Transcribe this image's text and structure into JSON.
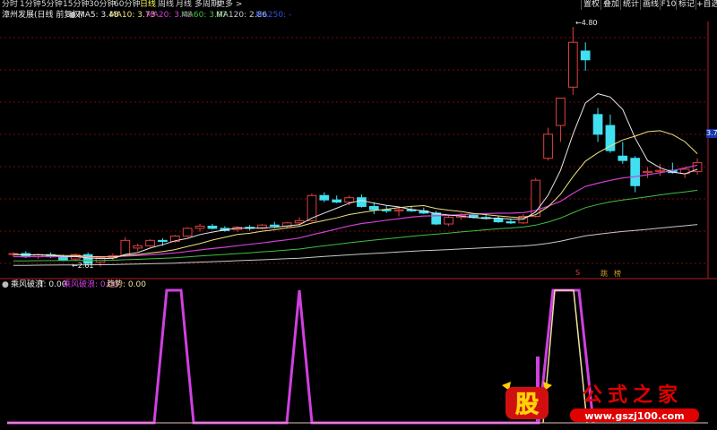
{
  "periods": [
    "分时",
    "1分钟",
    "5分钟",
    "15分钟",
    "30分钟",
    "60分钟",
    "日线",
    "周线",
    "月线",
    "多周期",
    "更多 >"
  ],
  "active_period": "日线",
  "right_buttons": [
    "置权",
    "叠加",
    "统计",
    "画线",
    "F10",
    "标记",
    "+自选"
  ],
  "chart_header": {
    "stock_label": "漳州发展(日线 前复权)",
    "ma5": "MA5: 3.48",
    "ma10": "MA10: 3.73",
    "ma20": "MA20: 3.48",
    "ma60": "MA60: 3.07",
    "ma120": "MA120: 2.86",
    "ma250": "MA250: -"
  },
  "high_label": "4.80",
  "low_label": "2.61",
  "price_tag": "3.7",
  "signal_marks": [
    "S",
    "跳",
    "榜"
  ],
  "indicator_header": {
    "name": "乘风破浪",
    "t_value": "T: 0.00",
    "series_value": "乘风破浪: 0.00",
    "trend_value": "趋势: 0.00"
  },
  "watermark": {
    "logo_char": "股",
    "title": "公式之家",
    "url": "www.gszj100.com"
  },
  "colors": {
    "up": "#e04040",
    "down": "#40e0f0",
    "ma5": "#e8e8e8",
    "ma10": "#f0e080",
    "ma20": "#d040d0",
    "ma60": "#40c040",
    "ma120": "#c8c8c8",
    "indicator": "#d040e0",
    "trend": "#f0e0a0",
    "grid": "#7a0a0a"
  },
  "candles": [
    [
      2.72,
      2.74,
      2.7,
      2.73
    ],
    [
      2.73,
      2.75,
      2.69,
      2.7
    ],
    [
      2.7,
      2.73,
      2.68,
      2.72
    ],
    [
      2.72,
      2.74,
      2.69,
      2.7
    ],
    [
      2.7,
      2.72,
      2.66,
      2.67
    ],
    [
      2.68,
      2.73,
      2.66,
      2.72
    ],
    [
      2.72,
      2.74,
      2.63,
      2.64
    ],
    [
      2.65,
      2.7,
      2.61,
      2.69
    ],
    [
      2.69,
      2.73,
      2.67,
      2.71
    ],
    [
      2.71,
      2.88,
      2.7,
      2.85
    ],
    [
      2.78,
      2.82,
      2.75,
      2.8
    ],
    [
      2.8,
      2.86,
      2.79,
      2.85
    ],
    [
      2.85,
      2.87,
      2.8,
      2.84
    ],
    [
      2.84,
      2.9,
      2.83,
      2.89
    ],
    [
      2.89,
      2.97,
      2.88,
      2.96
    ],
    [
      2.96,
      3.0,
      2.93,
      2.98
    ],
    [
      2.98,
      3.0,
      2.95,
      2.96
    ],
    [
      2.96,
      2.98,
      2.93,
      2.94
    ],
    [
      2.95,
      2.98,
      2.93,
      2.97
    ],
    [
      2.97,
      2.99,
      2.94,
      2.96
    ],
    [
      2.96,
      3.0,
      2.95,
      2.99
    ],
    [
      2.99,
      3.02,
      2.96,
      2.98
    ],
    [
      2.98,
      3.02,
      2.96,
      3.01
    ],
    [
      3.01,
      3.06,
      2.98,
      3.03
    ],
    [
      3.03,
      3.28,
      3.02,
      3.26
    ],
    [
      3.26,
      3.29,
      3.2,
      3.22
    ],
    [
      3.22,
      3.26,
      3.19,
      3.2
    ],
    [
      3.2,
      3.26,
      3.17,
      3.24
    ],
    [
      3.24,
      3.27,
      3.15,
      3.16
    ],
    [
      3.16,
      3.2,
      3.09,
      3.13
    ],
    [
      3.13,
      3.17,
      3.1,
      3.12
    ],
    [
      3.12,
      3.15,
      3.07,
      3.13
    ],
    [
      3.13,
      3.16,
      3.11,
      3.12
    ],
    [
      3.12,
      3.15,
      3.09,
      3.1
    ],
    [
      3.1,
      3.12,
      2.99,
      3.0
    ],
    [
      3.0,
      3.08,
      2.98,
      3.06
    ],
    [
      3.06,
      3.1,
      3.04,
      3.08
    ],
    [
      3.08,
      3.1,
      3.05,
      3.06
    ],
    [
      3.06,
      3.09,
      3.04,
      3.05
    ],
    [
      3.05,
      3.07,
      3.01,
      3.02
    ],
    [
      3.02,
      3.05,
      3.0,
      3.01
    ],
    [
      3.01,
      3.09,
      3.0,
      3.07
    ],
    [
      3.07,
      3.42,
      3.06,
      3.4
    ],
    [
      3.6,
      3.88,
      3.58,
      3.82
    ],
    [
      3.9,
      4.15,
      3.75,
      4.15
    ],
    [
      4.25,
      4.8,
      4.18,
      4.66
    ],
    [
      4.58,
      4.66,
      4.4,
      4.5
    ],
    [
      4.0,
      4.06,
      3.75,
      3.82
    ],
    [
      3.9,
      4.0,
      3.65,
      3.67
    ],
    [
      3.62,
      3.75,
      3.55,
      3.58
    ],
    [
      3.6,
      3.62,
      3.29,
      3.35
    ],
    [
      3.47,
      3.52,
      3.42,
      3.48
    ],
    [
      3.48,
      3.55,
      3.44,
      3.49
    ],
    [
      3.49,
      3.56,
      3.46,
      3.47
    ],
    [
      3.46,
      3.52,
      3.42,
      3.5
    ],
    [
      3.48,
      3.6,
      3.45,
      3.56
    ]
  ]
}
